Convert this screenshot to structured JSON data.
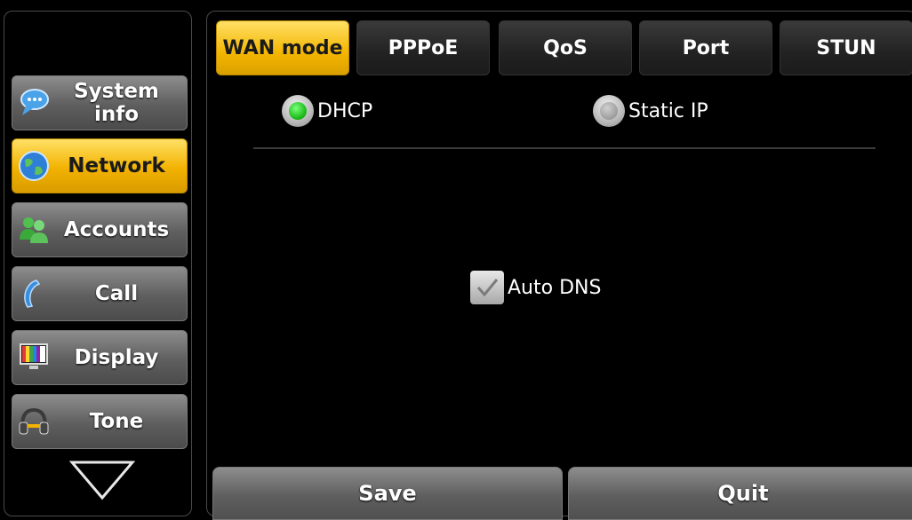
{
  "sidebar": {
    "items": [
      {
        "label": "System info",
        "icon": "chat-bubble-icon"
      },
      {
        "label": "Network",
        "icon": "globe-icon",
        "active": true
      },
      {
        "label": "Accounts",
        "icon": "users-icon"
      },
      {
        "label": "Call",
        "icon": "phone-handset-icon"
      },
      {
        "label": "Display",
        "icon": "monitor-icon"
      },
      {
        "label": "Tone",
        "icon": "headphones-icon"
      }
    ],
    "more_icon": "triangle-down-icon"
  },
  "tabs": [
    {
      "label": "WAN mode",
      "active": true
    },
    {
      "label": "PPPoE"
    },
    {
      "label": "QoS"
    },
    {
      "label": "Port"
    },
    {
      "label": "STUN"
    }
  ],
  "wan": {
    "dhcp_label": "DHCP",
    "dhcp_selected": true,
    "static_label": "Static IP",
    "static_selected": false,
    "auto_dns_label": "Auto DNS",
    "auto_dns_checked": true
  },
  "actions": {
    "save_label": "Save",
    "quit_label": "Quit"
  },
  "colors": {
    "accent": "#f2b200",
    "radio_on": "#1fbf1f"
  }
}
